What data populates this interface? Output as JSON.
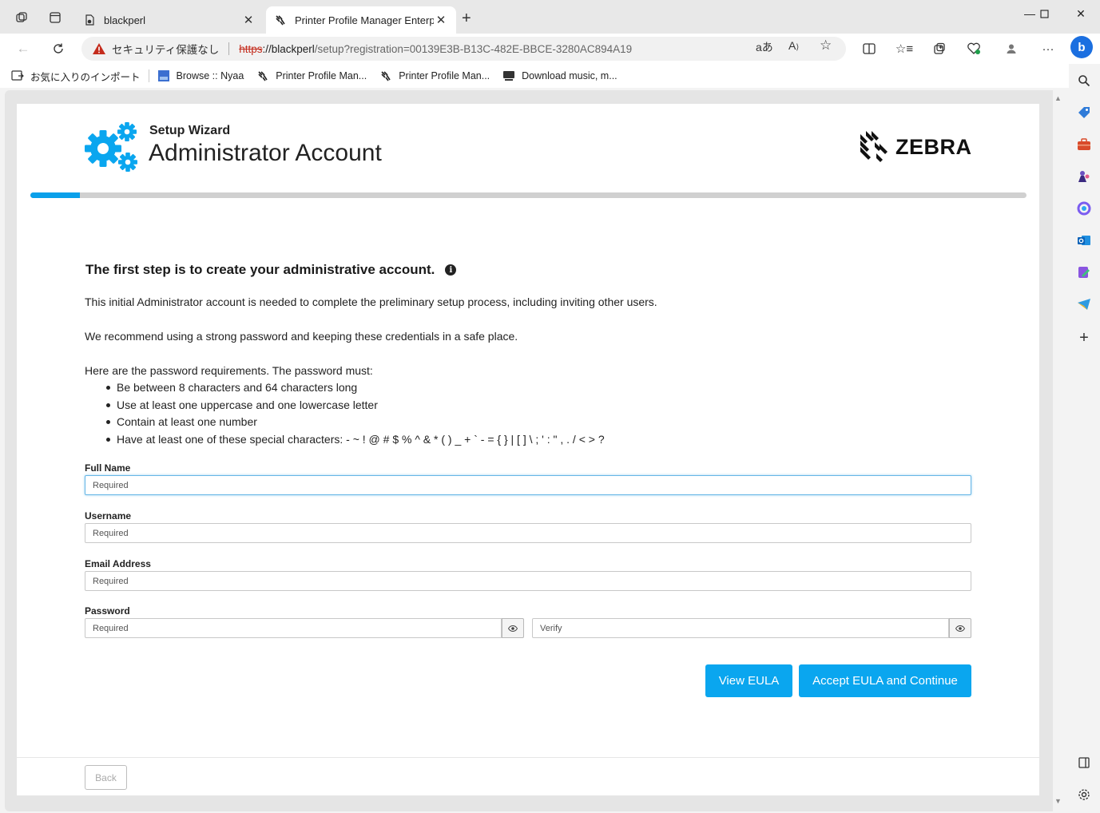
{
  "browser": {
    "tabs": [
      {
        "title": "blackperl",
        "active": false
      },
      {
        "title": "Printer Profile Manager Enterpris",
        "active": true
      }
    ],
    "address": {
      "security_label": "セキュリティ保護なし",
      "protocol": "https",
      "host": "://blackperl",
      "path": "/setup?registration=00139E3B-B13C-482E-BBCE-3280AC894A19"
    },
    "favorites": [
      {
        "label": "お気に入りのインポート",
        "icon": "import-icon"
      },
      {
        "label": "Browse :: Nyaa",
        "icon": "nyaa-icon"
      },
      {
        "label": "Printer Profile Man...",
        "icon": "zebra-icon"
      },
      {
        "label": "Printer Profile Man...",
        "icon": "zebra-icon"
      },
      {
        "label": "Download music, m...",
        "icon": "download-icon"
      }
    ]
  },
  "wizard": {
    "subtitle": "Setup Wizard",
    "title": "Administrator Account",
    "brand": "ZEBRA",
    "progress_fraction": 0.05,
    "accent_color": "#0aa6ef"
  },
  "content": {
    "heading": "The first step is to create your administrative account.",
    "intro": "This initial Administrator account is needed to complete the preliminary setup process, including inviting other users.",
    "recommend": "We recommend using a strong password and keeping these credentials in a safe place.",
    "req_intro": "Here are the password requirements. The password must:",
    "requirements": [
      "Be between 8 characters and 64 characters long",
      "Use at least one uppercase and one lowercase letter",
      "Contain at least one number",
      "Have at least one of these special characters: - ~ ! @ # $ % ^ & * ( ) _ + ` - = { } | [ ] \\ ; ' : \" , . / < > ?"
    ]
  },
  "form": {
    "full_name": {
      "label": "Full Name",
      "placeholder": "Required",
      "value": ""
    },
    "username": {
      "label": "Username",
      "placeholder": "Required",
      "value": ""
    },
    "email": {
      "label": "Email Address",
      "placeholder": "Required",
      "value": ""
    },
    "password": {
      "label": "Password",
      "placeholder": "Required",
      "verify_placeholder": "Verify",
      "value": ""
    }
  },
  "actions": {
    "view_eula": "View EULA",
    "accept": "Accept EULA and Continue",
    "back": "Back"
  }
}
